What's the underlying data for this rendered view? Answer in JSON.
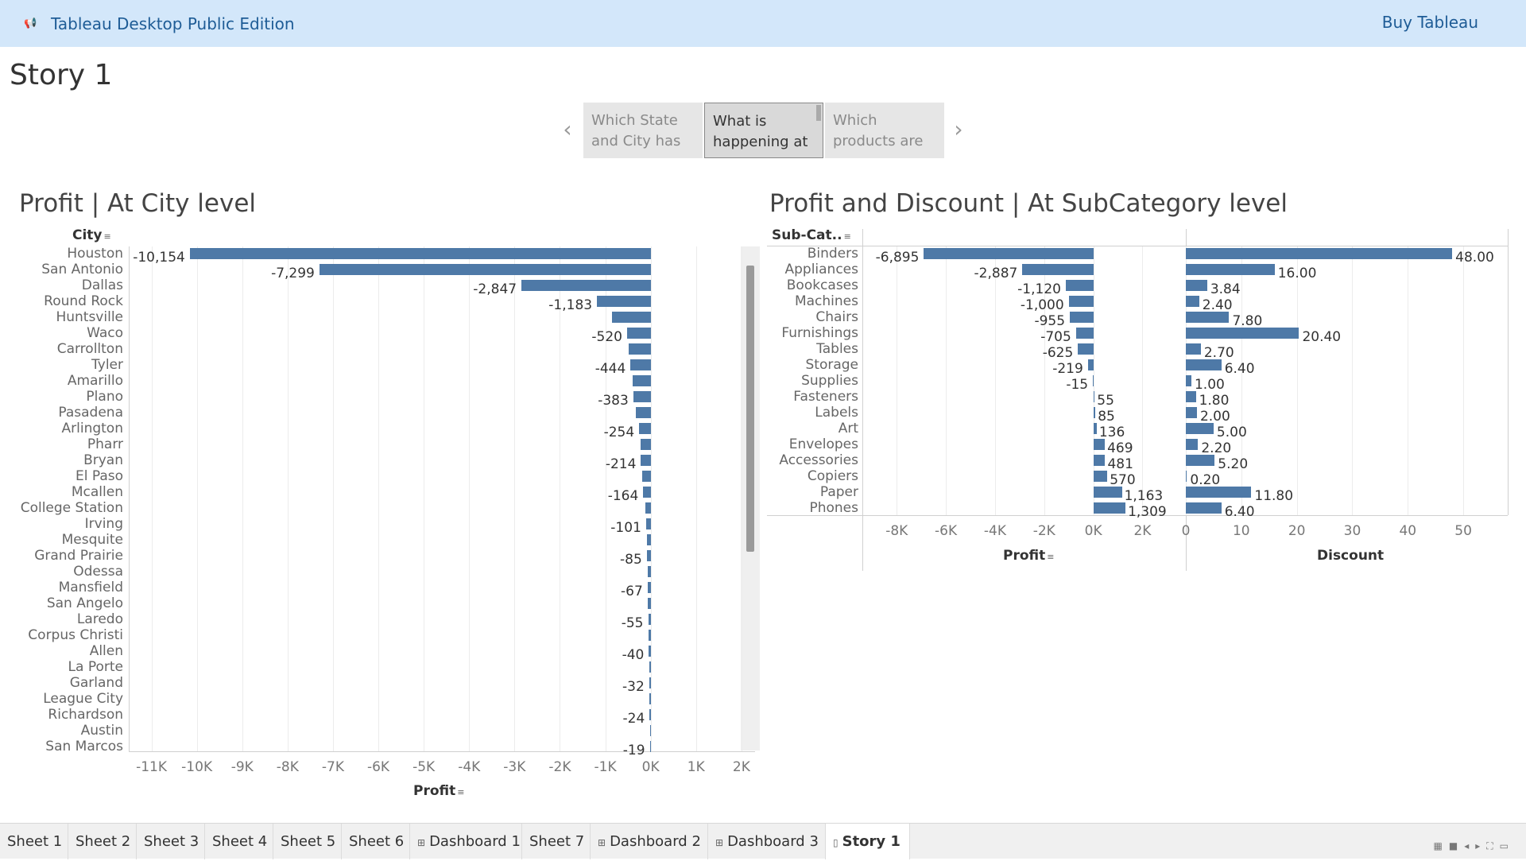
{
  "header": {
    "app_title": "Tableau Desktop Public Edition",
    "buy_label": "Buy Tableau",
    "icon": "megaphone-icon"
  },
  "story": {
    "title": "Story 1"
  },
  "navigator": {
    "points": [
      {
        "line1": "Which State",
        "line2": "and City has",
        "active": false
      },
      {
        "line1": "What is",
        "line2": "happening at",
        "active": true
      },
      {
        "line1": "Which",
        "line2": "products are",
        "active": false
      }
    ]
  },
  "left_panel": {
    "title": "Profit | At City level",
    "dim_header": "City",
    "measure_header": "Profit"
  },
  "right_panel": {
    "title": "Profit and Discount | At SubCategory level",
    "dim_header": "Sub-Cat..",
    "profit_header": "Profit",
    "discount_header": "Discount"
  },
  "chart_data": [
    {
      "type": "bar",
      "orientation": "horizontal",
      "title": "Profit | At City level",
      "ylabel": "City",
      "xlabel": "Profit",
      "x_ticks": [
        "-11K",
        "-10K",
        "-9K",
        "-8K",
        "-7K",
        "-6K",
        "-5K",
        "-4K",
        "-3K",
        "-2K",
        "-1K",
        "0K",
        "1K",
        "2K"
      ],
      "xlim": [
        -11500,
        2300
      ],
      "categories": [
        "Houston",
        "San Antonio",
        "Dallas",
        "Round Rock",
        "Huntsville",
        "Waco",
        "Carrollton",
        "Tyler",
        "Amarillo",
        "Plano",
        "Pasadena",
        "Arlington",
        "Pharr",
        "Bryan",
        "El Paso",
        "Mcallen",
        "College Station",
        "Irving",
        "Mesquite",
        "Grand Prairie",
        "Odessa",
        "Mansfield",
        "San Angelo",
        "Laredo",
        "Corpus Christi",
        "Allen",
        "La Porte",
        "Garland",
        "League City",
        "Richardson",
        "Austin",
        "San Marcos"
      ],
      "values": [
        -10154,
        -7299,
        -2847,
        -1183,
        -850,
        -520,
        -480,
        -444,
        -400,
        -383,
        -330,
        -254,
        -230,
        -214,
        -180,
        -164,
        -120,
        -101,
        -90,
        -85,
        -70,
        -67,
        -60,
        -55,
        -45,
        -40,
        -35,
        -32,
        -28,
        -24,
        -20,
        -19
      ],
      "labels": [
        "-10,154",
        "-7,299",
        "-2,847",
        "-1,183",
        "",
        "-520",
        "",
        "-444",
        "",
        "-383",
        "",
        "-254",
        "",
        "-214",
        "",
        "-164",
        "",
        "-101",
        "",
        "-85",
        "",
        "-67",
        "",
        "-55",
        "",
        "-40",
        "",
        "-32",
        "",
        "-24",
        "",
        "-19"
      ]
    },
    {
      "type": "bar",
      "orientation": "horizontal",
      "title": "Profit and Discount | At SubCategory level",
      "ylabel": "Sub-Cat..",
      "categories": [
        "Binders",
        "Appliances",
        "Bookcases",
        "Machines",
        "Chairs",
        "Furnishings",
        "Tables",
        "Storage",
        "Supplies",
        "Fasteners",
        "Labels",
        "Art",
        "Envelopes",
        "Accessories",
        "Copiers",
        "Paper",
        "Phones"
      ],
      "series": [
        {
          "name": "Profit",
          "x_ticks": [
            "-8K",
            "-6K",
            "-4K",
            "-2K",
            "0K",
            "2K"
          ],
          "xlim": [
            -9400,
            3700
          ],
          "values": [
            -6895,
            -2887,
            -1120,
            -1000,
            -955,
            -705,
            -625,
            -219,
            -15,
            55,
            85,
            136,
            469,
            481,
            570,
            1163,
            1309
          ],
          "labels": [
            "-6,895",
            "-2,887",
            "-1,120",
            "-1,000",
            "-955",
            "-705",
            "-625",
            "-219",
            "-15",
            "55",
            "85",
            "136",
            "469",
            "481",
            "570",
            "1,163",
            "1,309"
          ]
        },
        {
          "name": "Discount",
          "x_ticks": [
            "0",
            "10",
            "20",
            "30",
            "40",
            "50"
          ],
          "xlim": [
            0,
            58
          ],
          "values": [
            48.0,
            16.0,
            3.84,
            2.4,
            7.8,
            20.4,
            2.7,
            6.4,
            1.0,
            1.8,
            2.0,
            5.0,
            2.2,
            5.2,
            0.2,
            11.8,
            6.4
          ],
          "labels": [
            "48.00",
            "16.00",
            "3.84",
            "2.40",
            "7.80",
            "20.40",
            "2.70",
            "6.40",
            "1.00",
            "1.80",
            "2.00",
            "5.00",
            "2.20",
            "5.20",
            "0.20",
            "11.80",
            "6.40"
          ]
        }
      ]
    }
  ],
  "tabs": [
    {
      "label": "Sheet 1",
      "icon": "",
      "active": false
    },
    {
      "label": "Sheet 2",
      "icon": "",
      "active": false
    },
    {
      "label": "Sheet 3",
      "icon": "",
      "active": false
    },
    {
      "label": "Sheet 4",
      "icon": "",
      "active": false
    },
    {
      "label": "Sheet 5",
      "icon": "",
      "active": false
    },
    {
      "label": "Sheet 6",
      "icon": "",
      "active": false
    },
    {
      "label": "Dashboard 1",
      "icon": "dashboard-icon",
      "active": false
    },
    {
      "label": "Sheet 7",
      "icon": "",
      "active": false
    },
    {
      "label": "Dashboard 2",
      "icon": "dashboard-icon",
      "active": false
    },
    {
      "label": "Dashboard 3",
      "icon": "dashboard-icon",
      "active": false
    },
    {
      "label": "Story 1",
      "icon": "story-icon",
      "active": true
    }
  ],
  "colors": {
    "bar": "#4e79a7",
    "header_bg": "#d3e7fa",
    "header_text": "#1e5c96"
  }
}
